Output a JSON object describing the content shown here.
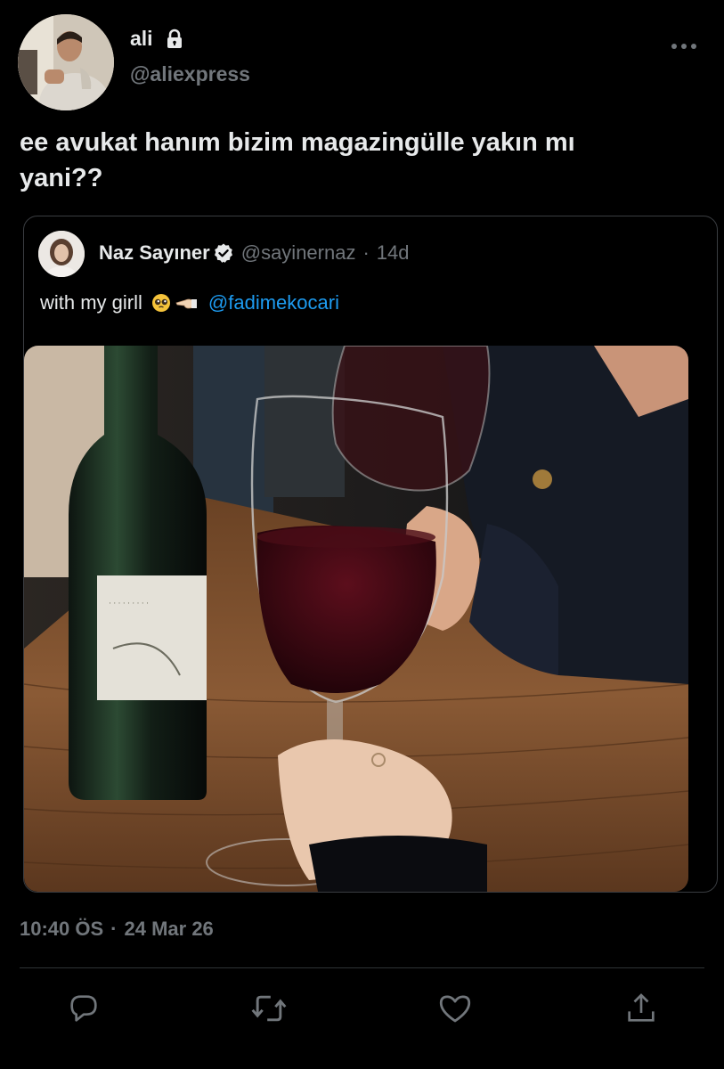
{
  "author": {
    "display_name": "ali",
    "handle": "@aliexpress",
    "avatar_icon": "avatar-photo",
    "protected_icon": "lock-icon"
  },
  "tweet": {
    "text": "ee avukat hanım bizim magazingülle yakın mı\nyani??",
    "time": "10:40 ÖS",
    "separator": "·",
    "date": "24 Mar 26"
  },
  "quoted_tweet": {
    "display_name": "Naz Sayıner",
    "handle": "@sayinernaz",
    "separator": "·",
    "age": "14d",
    "text": "with my girll",
    "emojis": [
      "pleading-face-emoji",
      "backhand-pointing-left-emoji"
    ],
    "mention": "@fadimekocari",
    "verified_icon": "verified-badge-icon",
    "photo": "photo-wine-glasses-bottle"
  },
  "actions": [
    "reply-icon",
    "retweet-icon",
    "like-icon",
    "share-icon"
  ],
  "colors": {
    "background": "#000000",
    "text": "#e7e9ea",
    "muted": "#71767b",
    "link": "#1d9bf0",
    "border": "#3a3d41"
  }
}
